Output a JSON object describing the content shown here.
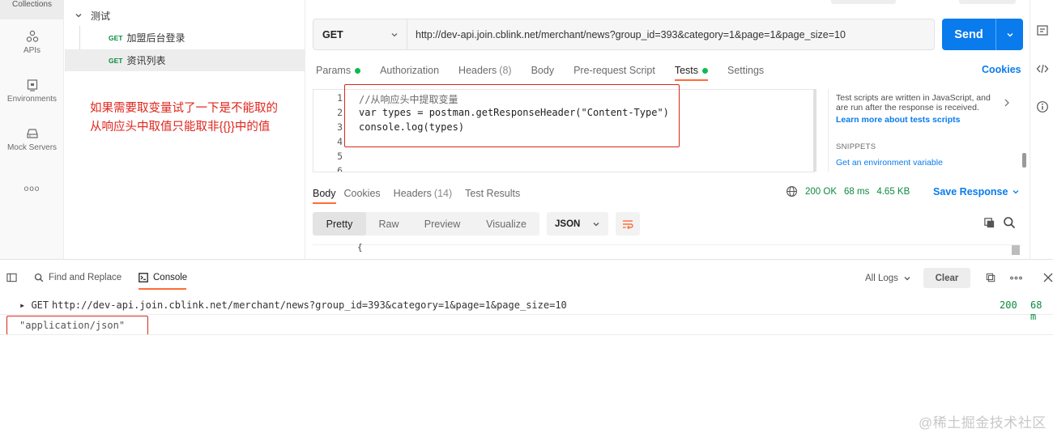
{
  "rail": {
    "collections": "Collections",
    "apis": "APIs",
    "environments": "Environments",
    "mock_servers": "Mock Servers",
    "more": "ooo"
  },
  "tree": {
    "folder": "测试",
    "requests": [
      {
        "method": "GET",
        "name": "加盟后台登录"
      },
      {
        "method": "GET",
        "name": "资讯列表"
      }
    ]
  },
  "annotation": {
    "line1": "如果需要取变量试了一下是不能取的",
    "line2": "从响应头中取值只能取非{{}}中的值"
  },
  "request": {
    "method": "GET",
    "url": "http://dev-api.join.cblink.net/merchant/news?group_id=393&category=1&page=1&page_size=10",
    "send": "Send",
    "cookies": "Cookies",
    "tabs": [
      {
        "label": "Params",
        "dot": true
      },
      {
        "label": "Authorization"
      },
      {
        "label": "Headers",
        "count": "(8)"
      },
      {
        "label": "Body"
      },
      {
        "label": "Pre-request Script"
      },
      {
        "label": "Tests",
        "dot": true,
        "active": true
      },
      {
        "label": "Settings"
      }
    ]
  },
  "editor": {
    "lines": [
      {
        "n": "1",
        "text": "//从响应头中提取变量",
        "comment": true
      },
      {
        "n": "2",
        "text": "var types = postman.getResponseHeader(\"Content-Type\")"
      },
      {
        "n": "3",
        "text": "console.log(types)"
      },
      {
        "n": "4",
        "text": ""
      },
      {
        "n": "5",
        "text": ""
      },
      {
        "n": "6",
        "text": ""
      }
    ]
  },
  "snippets_panel": {
    "info_line1": "Test scripts are written in JavaScript, and",
    "info_line2": "are run after the response is received.",
    "learn_more": "Learn more about tests scripts",
    "heading": "SNIPPETS",
    "first_snippet": "Get an environment variable"
  },
  "response": {
    "tabs": [
      {
        "label": "Body",
        "active": true
      },
      {
        "label": "Cookies"
      },
      {
        "label": "Headers",
        "count": "(14)"
      },
      {
        "label": "Test Results"
      }
    ],
    "status": "200 OK",
    "time": "68 ms",
    "size": "4.65 KB",
    "save": "Save Response",
    "views": [
      "Pretty",
      "Raw",
      "Preview",
      "Visualize"
    ],
    "active_view": "Pretty",
    "format": "JSON",
    "body_first_char": "{"
  },
  "console_bar": {
    "find_replace": "Find and Replace",
    "console": "Console",
    "all_logs": "All Logs",
    "clear": "Clear"
  },
  "logs": [
    {
      "prefix": "▸ GET",
      "url": "http://dev-api.join.cblink.net/merchant/news?group_id=393&category=1&page=1&page_size=10",
      "status": "200",
      "time": "68 m"
    },
    {
      "value": "\"application/json\""
    }
  ],
  "watermark": "@稀土掘金技术社区",
  "colors": {
    "accent_orange": "#ff6c37",
    "send_blue": "#097bed",
    "get_green": "#0c8a3e",
    "annotation_red": "#e0241c"
  }
}
